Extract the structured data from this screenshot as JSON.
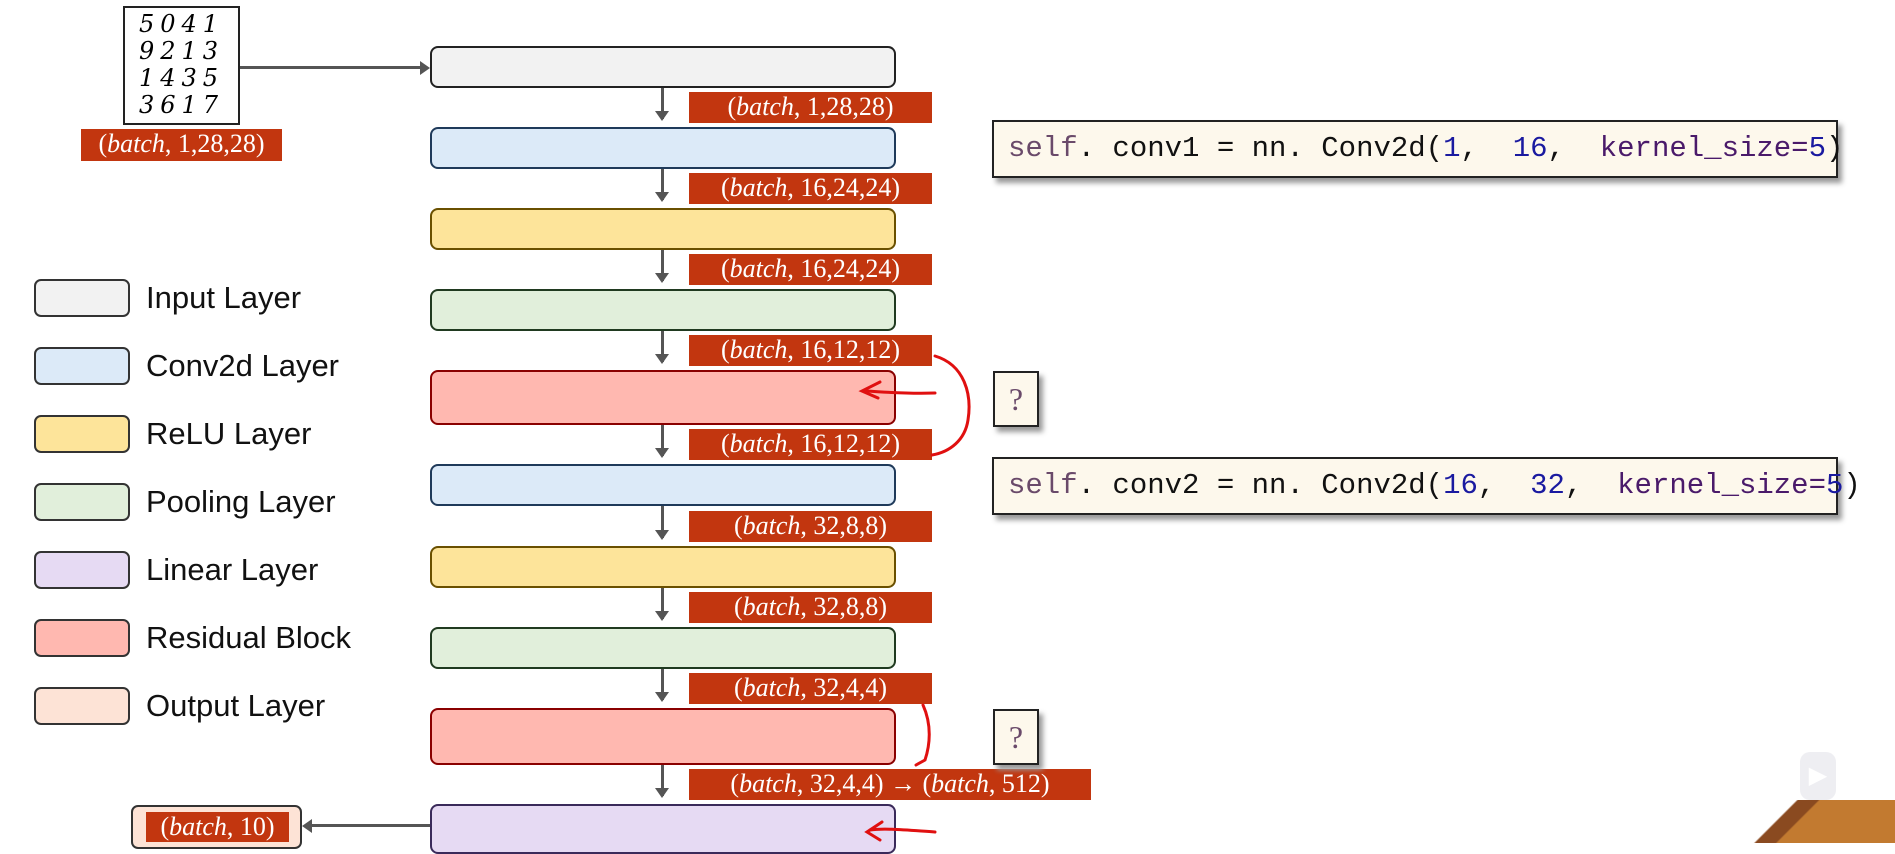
{
  "digits_image": {
    "rows": [
      "5041",
      "9213",
      "1435",
      "3617"
    ]
  },
  "input_shape": {
    "prefix": "(",
    "var": "batch",
    "rest": ", 1,28,28)"
  },
  "layers": [
    {
      "type": "input",
      "color": "#f2f2f2",
      "border": "#222222"
    },
    {
      "type": "conv2d",
      "color": "#dceaf8",
      "border": "#1f3a5a"
    },
    {
      "type": "relu",
      "color": "#fde49a",
      "border": "#6a5000"
    },
    {
      "type": "pooling",
      "color": "#e1efdb",
      "border": "#203a20"
    },
    {
      "type": "residual",
      "color": "#ffb8b0",
      "border": "#8a0000"
    },
    {
      "type": "conv2d",
      "color": "#dceaf8",
      "border": "#1f3a5a"
    },
    {
      "type": "relu",
      "color": "#fde49a",
      "border": "#6a5000"
    },
    {
      "type": "pooling",
      "color": "#e1efdb",
      "border": "#203a20"
    },
    {
      "type": "residual",
      "color": "#ffb8b0",
      "border": "#8a0000"
    },
    {
      "type": "linear",
      "color": "#e6daf3",
      "border": "#3a2a5a"
    }
  ],
  "shapes": [
    {
      "var": "batch",
      "rest": ", 1,28,28)"
    },
    {
      "var": "batch",
      "rest": ", 16,24,24)"
    },
    {
      "var": "batch",
      "rest": ", 16,24,24)"
    },
    {
      "var": "batch",
      "rest": ", 16,12,12)"
    },
    {
      "var": "batch",
      "rest": ", 16,12,12)"
    },
    {
      "var": "batch",
      "rest": ", 32,8,8)"
    },
    {
      "var": "batch",
      "rest": ", 32,8,8)"
    },
    {
      "var": "batch",
      "rest": ", 32,4,4)"
    },
    {
      "var": "batch",
      "rest": ", 32,4,4) → (",
      "var2": "batch",
      "rest2": ", 512)"
    }
  ],
  "output_shape": {
    "var": "batch",
    "rest": ", 10)"
  },
  "legend": [
    {
      "label": "Input Layer",
      "color": "#f2f2f2"
    },
    {
      "label": "Conv2d Layer",
      "color": "#dceaf8"
    },
    {
      "label": "ReLU Layer",
      "color": "#fde49a"
    },
    {
      "label": "Pooling Layer",
      "color": "#e1efdb"
    },
    {
      "label": "Linear Layer",
      "color": "#e6daf3"
    },
    {
      "label": "Residual Block",
      "color": "#ffb8b0"
    },
    {
      "label": "Output Layer",
      "color": "#fde3d6"
    }
  ],
  "code": [
    {
      "self": "self",
      "mid": ". conv1 = nn. Conv2d(",
      "a": "1",
      "sep": ",  ",
      "b": "16",
      "sep2": ",  ",
      "kw": "kernel_size=",
      "k": "5",
      "end": ")"
    },
    {
      "self": "self",
      "mid": ". conv2 = nn. Conv2d(",
      "a": "16",
      "sep": ",  ",
      "b": "32",
      "sep2": ",  ",
      "kw": "kernel_size=",
      "k": "5",
      "end": ")"
    }
  ],
  "question_boxes": [
    "?",
    "?"
  ],
  "colors": {
    "shape_label": "#c2360f",
    "annotation": "#e01010",
    "code_number": "#1a1aa0",
    "code_keyword": "#4a1a6a"
  }
}
